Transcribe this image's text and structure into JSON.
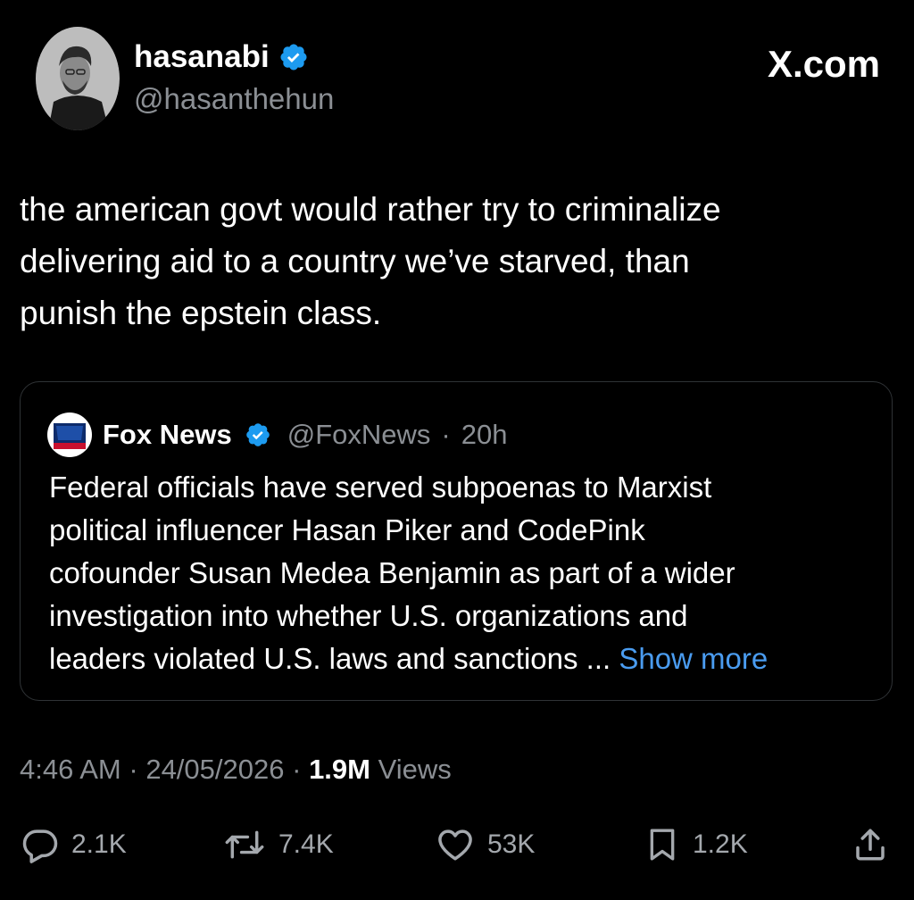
{
  "author": {
    "display_name": "hasanabi",
    "handle": "@hasanthehun",
    "verified": true
  },
  "site_label": "X.com",
  "tweet_lines": [
    "the american govt would rather try to criminalize",
    "delivering aid to a country we’ve starved, than",
    "punish the epstein class."
  ],
  "quote": {
    "display_name": "Fox News",
    "handle": "@FoxNews",
    "separator": "·",
    "time": "20h",
    "lines": [
      "Federal officials have served subpoenas to Marxist",
      "political influencer Hasan Piker and CodePink",
      "cofounder Susan Medea Benjamin as part of a wider",
      "investigation into whether U.S. organizations and"
    ],
    "last_line": "leaders violated U.S. laws and sanctions ...",
    "show_more": "Show more"
  },
  "meta": {
    "time": "4:46 AM",
    "date": "24/05/2026",
    "separator": "·",
    "views_count": "1.9M",
    "views_label": "Views"
  },
  "actions": {
    "replies": "2.1K",
    "reposts": "7.4K",
    "likes": "53K",
    "bookmarks": "1.2K"
  },
  "colors": {
    "background": "#000000",
    "text": "#ffffff",
    "secondary": "#8b8f94",
    "link": "#4a9cf0",
    "verified": "#1d9bf0"
  }
}
